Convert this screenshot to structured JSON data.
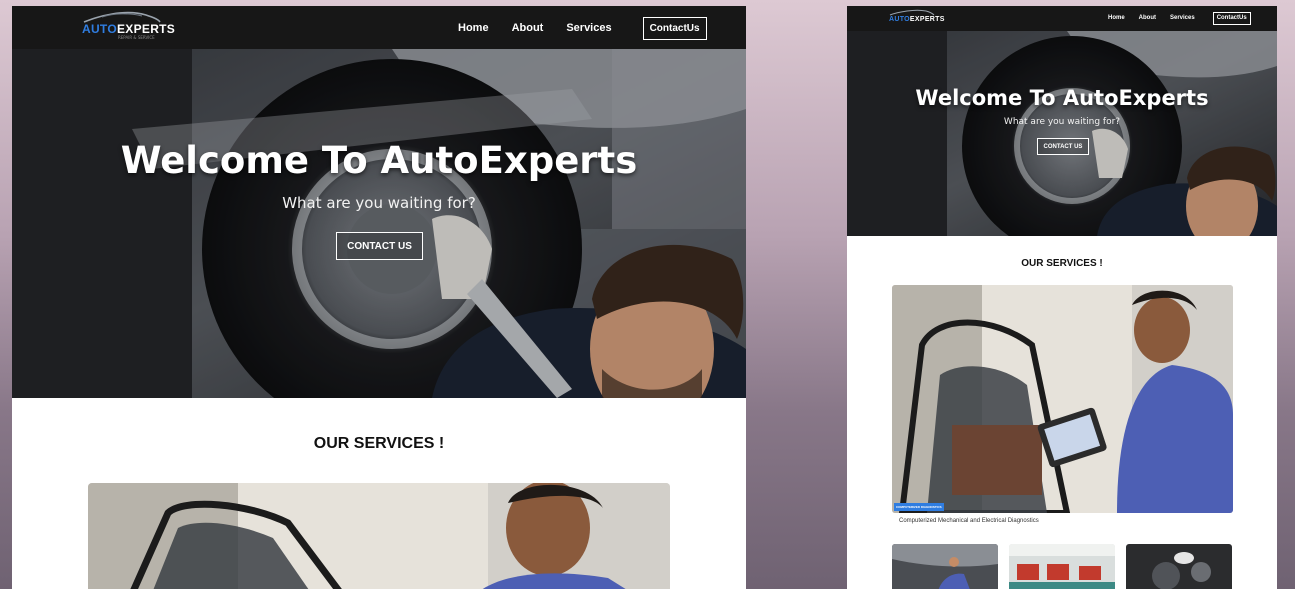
{
  "brand": {
    "logo_part1": "AUTO",
    "logo_part2": "EXPERTS",
    "logo_tagline": "REPAIR & SERVICE"
  },
  "desktop": {
    "nav": {
      "home": "Home",
      "about": "About",
      "services": "Services",
      "contact": "ContactUs"
    },
    "hero": {
      "title": "Welcome To AutoExperts",
      "subtitle": "What are you waiting for?",
      "cta": "CONTACT US"
    },
    "services_title": "OUR SERVICES !"
  },
  "mobile": {
    "nav": {
      "home": "Home",
      "about": "About",
      "services": "Services",
      "contact": "ContactUs"
    },
    "hero": {
      "title": "Welcome To AutoExperts",
      "subtitle": "What are you waiting for?",
      "cta": "CONTACT US"
    },
    "services_title": "OUR SERVICES !",
    "card": {
      "tag": "COMPUTERIZED DIAGNOSTICS",
      "caption": "Computerized Mechanical and Electrical Diagnostics"
    }
  },
  "colors": {
    "nav_bg": "#171717",
    "accent": "#2f7de1",
    "page_bg": "#b8a2b2"
  },
  "icons": [
    "car-logo-icon"
  ]
}
